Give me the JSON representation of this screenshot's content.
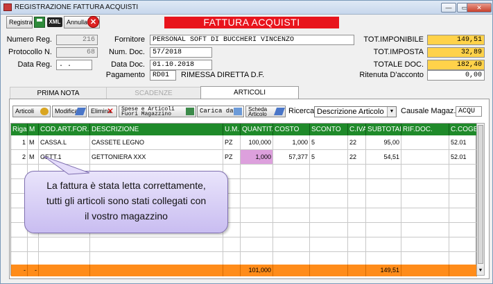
{
  "window": {
    "title": "REGISTRAZIONE FATTURA ACQUISTI",
    "banner": "FATTURA ACQUISTI"
  },
  "toolbar": {
    "registra_label": "Registra",
    "xml_label": "XML",
    "annulla_label": "Annulla"
  },
  "header": {
    "numero_reg": {
      "label": "Numero Reg.",
      "value": "216"
    },
    "protocollo": {
      "label": "Protocollo N.",
      "value": "68"
    },
    "data_reg": {
      "label": "Data Reg.",
      "value": ". ."
    },
    "fornitore": {
      "label": "Fornitore",
      "value": "PERSONAL SOFT DI BUCCHERI VINCENZO"
    },
    "num_doc": {
      "label": "Num. Doc.",
      "value": "57/2018"
    },
    "data_doc": {
      "label": "Data Doc.",
      "value": "01.10.2018"
    },
    "pagamento": {
      "label": "Pagamento",
      "code": "RD01",
      "desc": "RIMESSA DIRETTA D.F."
    }
  },
  "totals": {
    "imponibile": {
      "label": "TOT.IMPONIBILE",
      "value": "149,51"
    },
    "imposta": {
      "label": "TOT.IMPOSTA",
      "value": "32,89"
    },
    "totale": {
      "label": "TOTALE DOC.",
      "value": "182,40"
    },
    "ritenuta": {
      "label": "Ritenuta D'acconto",
      "value": "0,00"
    }
  },
  "tabs": {
    "prima_nota": "PRIMA NOTA",
    "scadenze": "SCADENZE",
    "articoli": "ARTICOLI"
  },
  "buttons": {
    "articoli": "Articoli",
    "modifica": "Modifica",
    "elimina": "Elimina",
    "spese_line1": "Spese e Articoli",
    "spese_line2": "Fuori Magazzino",
    "carica": "Carica da",
    "scheda_line1": "Scheda",
    "scheda_line2": "Articolo"
  },
  "ricerca": {
    "label": "Ricerca",
    "selected": "Descrizione Articolo"
  },
  "causale": {
    "label": "Causale Magaz.",
    "value": "ACQU"
  },
  "table": {
    "columns": [
      "Riga",
      "M",
      "COD.ART.FOR.",
      "DESCRIZIONE",
      "U.M.",
      "QUANTITA'",
      "COSTO",
      "SCONTO",
      "C.IVA",
      "SUBTOTALE",
      "RIF.DOC.",
      "C.COGE"
    ],
    "rows": [
      [
        "1",
        "M",
        "CASSA.L",
        "CASSETE LEGNO",
        "PZ",
        "100,000",
        "1,000",
        "5",
        "22",
        "95,00",
        "",
        "52.01"
      ],
      [
        "2",
        "M",
        "GETT.1",
        "GETTONIERA XXX",
        "PZ",
        "1,000",
        "57,377",
        "5",
        "22",
        "54,51",
        "",
        "52.01"
      ]
    ],
    "footer": {
      "quantita": "101,000",
      "subtotale": "149,51",
      "riga": "-",
      "m": "-"
    }
  },
  "callout": {
    "line1": "La fattura è stata letta correttamente,",
    "line2": "tutti gli articoli sono stati collegati con",
    "line3": "il vostro magazzino"
  },
  "colors": {
    "banner": "#e8141c",
    "header_green": "#1f8a2a",
    "totals_yellow": "#ffd24a",
    "footer_orange": "#ff8c1a",
    "highlight_pink": "#dda0dd"
  }
}
